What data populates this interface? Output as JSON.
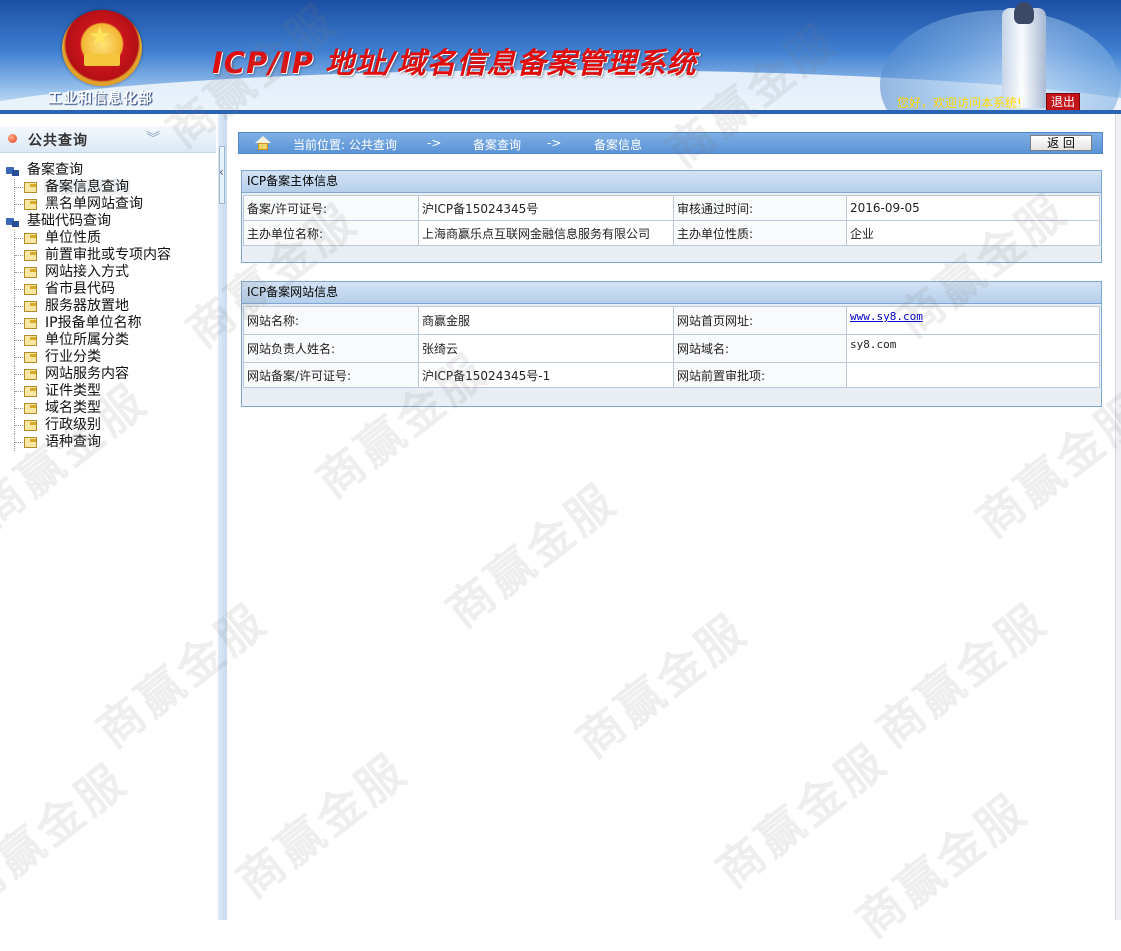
{
  "header": {
    "ministry": "工业和信息化部",
    "system_title": "ICP/IP 地址/域名信息备案管理系统",
    "welcome": "您好，欢迎访问本系统!",
    "logout": "退出"
  },
  "sidebar": {
    "heading": "公共查询",
    "tree": [
      {
        "label": "备案查询",
        "level": 0
      },
      {
        "label": "备案信息查询",
        "level": 1,
        "selected": true
      },
      {
        "label": "黑名单网站查询",
        "level": 1
      },
      {
        "label": "基础代码查询",
        "level": 0
      },
      {
        "label": "单位性质",
        "level": 1
      },
      {
        "label": "前置审批或专项内容",
        "level": 1
      },
      {
        "label": "网站接入方式",
        "level": 1
      },
      {
        "label": "省市县代码",
        "level": 1
      },
      {
        "label": "服务器放置地",
        "level": 1
      },
      {
        "label": "IP报备单位名称",
        "level": 1
      },
      {
        "label": "单位所属分类",
        "level": 1
      },
      {
        "label": "行业分类",
        "level": 1
      },
      {
        "label": "网站服务内容",
        "level": 1
      },
      {
        "label": "证件类型",
        "level": 1
      },
      {
        "label": "域名类型",
        "level": 1
      },
      {
        "label": "行政级别",
        "level": 1
      },
      {
        "label": "语种查询",
        "level": 1
      }
    ]
  },
  "breadcrumb": {
    "current_label": "当前位置: 公共查询",
    "sep1": "->",
    "item2": "备案查询",
    "sep2": "->",
    "item3": "备案信息",
    "back": "返 回"
  },
  "subject_panel": {
    "title": "ICP备案主体信息",
    "license_label": "备案/许可证号:",
    "license_value": "沪ICP备15024345号",
    "approve_time_label": "审核通过时间:",
    "approve_time_value": "2016-09-05",
    "org_name_label": "主办单位名称:",
    "org_name_value": "上海商赢乐点互联网金融信息服务有限公司",
    "org_type_label": "主办单位性质:",
    "org_type_value": "企业"
  },
  "site_panel": {
    "title": "ICP备案网站信息",
    "site_name_label": "网站名称:",
    "site_name_value": "商赢金服",
    "homepage_label": "网站首页网址:",
    "homepage_value": "www.sy8.com",
    "owner_label": "网站负责人姓名:",
    "owner_value": "张绮云",
    "domain_label": "网站域名:",
    "domain_value": "sy8.com",
    "site_license_label": "网站备案/许可证号:",
    "site_license_value": "沪ICP备15024345号-1",
    "pre_approval_label": "网站前置审批项:",
    "pre_approval_value": ""
  },
  "watermark_text": "商赢金服"
}
